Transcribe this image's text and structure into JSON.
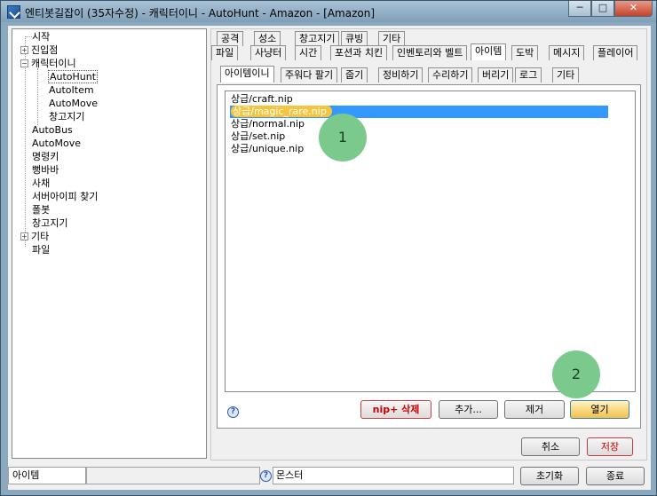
{
  "window": {
    "title": "엔티봇길잡이 (35자수정) - 캐릭터이니 - AutoHunt - Amazon - [Amazon]",
    "min_label": "─",
    "max_label": "□",
    "close_label": "✕"
  },
  "tree": {
    "items": [
      {
        "label": "시작",
        "exp": ""
      },
      {
        "label": "진입점",
        "exp": "+"
      },
      {
        "label": "캐릭터이니",
        "exp": "−"
      },
      {
        "label": "AutoHunt",
        "exp": ""
      },
      {
        "label": "AutoItem",
        "exp": ""
      },
      {
        "label": "AutoMove",
        "exp": ""
      },
      {
        "label": "창고지기",
        "exp": ""
      },
      {
        "label": "AutoBus",
        "exp": ""
      },
      {
        "label": "AutoMove",
        "exp": ""
      },
      {
        "label": "명령키",
        "exp": ""
      },
      {
        "label": "뻥바바",
        "exp": ""
      },
      {
        "label": "사채",
        "exp": ""
      },
      {
        "label": "서버아이피 찾기",
        "exp": ""
      },
      {
        "label": "폴봇",
        "exp": ""
      },
      {
        "label": "창고지기",
        "exp": ""
      },
      {
        "label": "기타",
        "exp": "+"
      },
      {
        "label": "파일",
        "exp": ""
      }
    ]
  },
  "tabs_row1": [
    "공격",
    "성소",
    "창고지기",
    "큐빙",
    "기타"
  ],
  "tabs_row2": [
    "파일",
    "사냥터",
    "시간",
    "포션과 치킨",
    "인벤토리와 벨트",
    "아이템",
    "도박",
    "메시지",
    "플레이어"
  ],
  "subtabs": [
    "아이템이니",
    "주워다 팔기",
    "줍기",
    "정비하기",
    "수리하기",
    "버리기",
    "로그",
    "기타"
  ],
  "files": [
    "상급/craft.nip",
    "상급/magic_rare.nip",
    "상급/normal.nip",
    "상급/set.nip",
    "상급/unique.nip"
  ],
  "callouts": [
    "1",
    "2"
  ],
  "buttons": {
    "delete": "nip+ 삭제",
    "add": "추가...",
    "remove": "제거",
    "open": "열기",
    "cancel": "취소",
    "save": "저장",
    "reset": "초기화",
    "exit": "종료"
  },
  "help_icon": "?",
  "status": {
    "left": "아이템",
    "mid": "몬스터"
  }
}
